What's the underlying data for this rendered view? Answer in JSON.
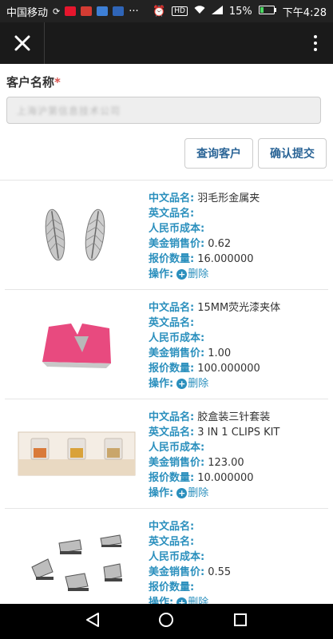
{
  "status_bar": {
    "carrier": "中国移动",
    "more": "···",
    "battery": "15%",
    "time": "下午4:28",
    "signal_badge": "HD"
  },
  "app_bar": {
    "close_icon": "close-icon",
    "menu_icon": "more-vertical-icon"
  },
  "form": {
    "customer_label": "客户名称",
    "required_mark": "*",
    "customer_value": "上海沪第信息技术公司",
    "query_button": "查询客户",
    "submit_button": "确认提交"
  },
  "field_labels": {
    "cn_name": "中文品名:",
    "en_name": "英文品名:",
    "rmb_cost": "人民币成本:",
    "usd_price": "美金销售价:",
    "quote_qty": "报价数量:",
    "operation": "操作:",
    "delete": "删除"
  },
  "products": [
    {
      "cn_name": "羽毛形金属夹",
      "en_name": "",
      "rmb_cost": "",
      "usd_price": "0.62",
      "quote_qty": "16.000000",
      "image": "feather-clip-image"
    },
    {
      "cn_name": "15MM荧光漆夹体",
      "en_name": "",
      "rmb_cost": "",
      "usd_price": "1.00",
      "quote_qty": "100.000000",
      "image": "pink-clip-image"
    },
    {
      "cn_name": "胶盒装三针套装",
      "en_name": "3 IN 1 CLIPS KIT",
      "rmb_cost": "",
      "usd_price": "123.00",
      "quote_qty": "10.000000",
      "image": "clips-kit-image"
    },
    {
      "cn_name": "",
      "en_name": "",
      "rmb_cost": "",
      "usd_price": "0.55",
      "quote_qty": "",
      "image": "silver-clips-image"
    }
  ],
  "colors": {
    "label_blue": "#2a8fbd",
    "button_text": "#2a6496",
    "required_red": "#d9534f",
    "app_bar": "#1a1a1a"
  }
}
